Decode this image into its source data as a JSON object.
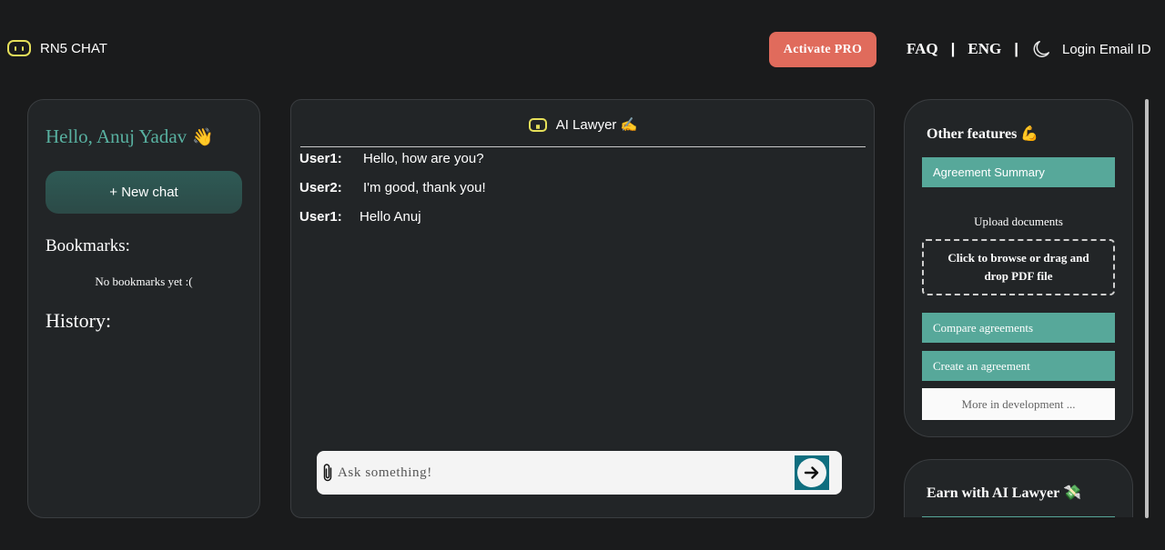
{
  "header": {
    "brand_icon": "robot-face-icon",
    "brand_name": "RN5 CHAT",
    "activate_label": "Activate PRO",
    "nav": {
      "faq": "FAQ",
      "separator": "|",
      "language": "ENG",
      "theme_icon": "moon-icon",
      "login": "Login Email ID"
    }
  },
  "sidebar": {
    "greeting": "Hello, Anuj Yadav",
    "greeting_emoji": "👋",
    "new_chat_label": "+ New chat",
    "bookmarks_heading": "Bookmarks:",
    "bookmarks_empty": "No bookmarks yet :(",
    "history_heading": "History:"
  },
  "chat": {
    "title": "AI Lawyer",
    "title_emoji": "✍️",
    "messages": [
      {
        "user": "User1:",
        "text": "Hello, how are you?"
      },
      {
        "user": "User2:",
        "text": "I'm good, thank you!"
      },
      {
        "user": "User1:",
        "text": "Hello Anuj"
      }
    ],
    "input_placeholder": "Ask something!",
    "attach_icon": "paperclip-icon",
    "send_icon": "arrow-right-icon"
  },
  "features": {
    "title": "Other features",
    "title_emoji": "💪",
    "summary_label": "Agreement Summary",
    "upload_label": "Upload documents",
    "dropzone_text": "Click to browse or drag and drop PDF file",
    "compare_label": "Compare agreements",
    "create_label": "Create an agreement",
    "more_label": "More in development ..."
  },
  "earn": {
    "title": "Earn with AI Lawyer",
    "title_emoji": "💸"
  },
  "colors": {
    "background": "#1a1b1c",
    "panel": "#222527",
    "accent_teal": "#57a89a",
    "greeting_teal": "#58b0a0",
    "activate_coral": "#e06b5c",
    "brand_yellow": "#e6e05a",
    "send_blue": "#0f6e7f"
  }
}
